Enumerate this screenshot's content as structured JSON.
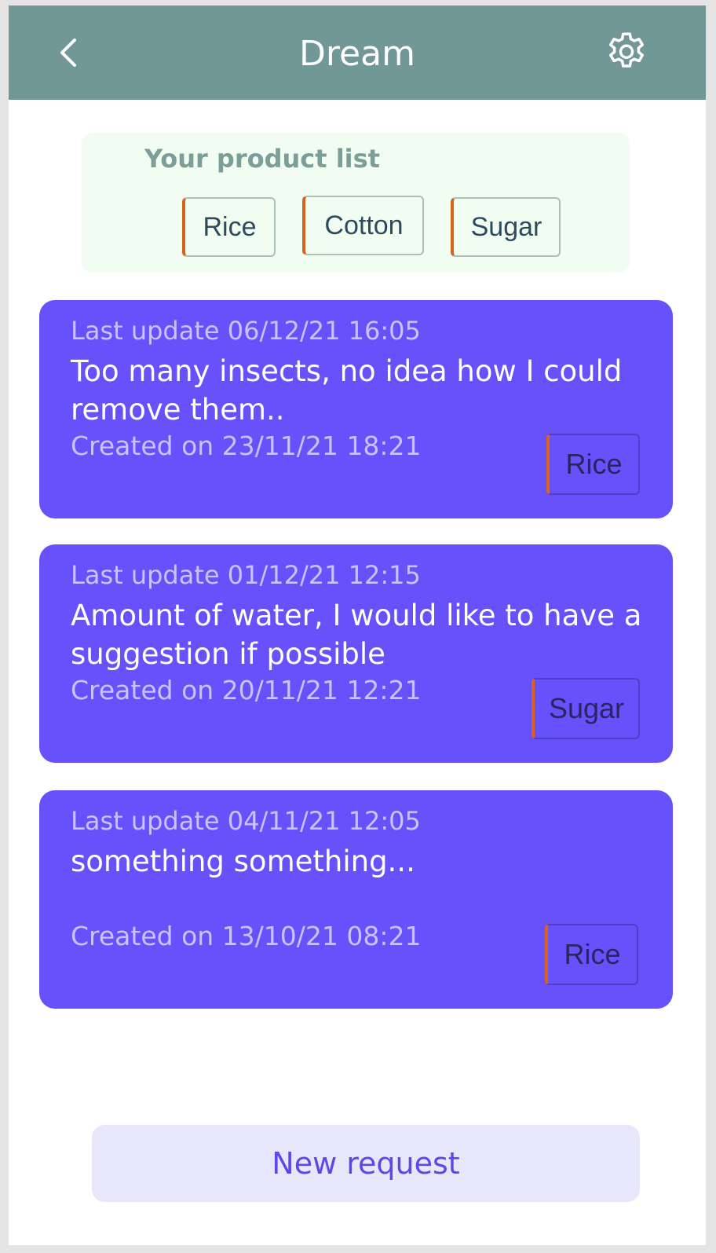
{
  "header": {
    "title": "Dream",
    "back_icon": "chevron-left-icon",
    "settings_icon": "gear-icon"
  },
  "product_list": {
    "title": "Your product list",
    "products": [
      "Rice",
      "Cotton",
      "Sugar"
    ]
  },
  "requests": [
    {
      "last_update": "Last update 06/12/21 16:05",
      "message": "Too many insects, no idea how I could remove them..",
      "created": "Created on 23/11/21 18:21",
      "tag": "Rice"
    },
    {
      "last_update": "Last update 01/12/21 12:15",
      "message": "Amount of water, I would like to have a suggestion if possible",
      "created": "Created on 20/11/21 12:21",
      "tag": "Sugar"
    },
    {
      "last_update": "Last update 04/11/21 12:05",
      "message": "something something...",
      "created": "Created on 13/10/21 08:21",
      "tag": "Rice"
    }
  ],
  "footer": {
    "new_request_label": "New request"
  },
  "colors": {
    "header": "#729797",
    "card": "#6651fb",
    "accent": "#d9631e",
    "product_box": "#f0fdf0",
    "button_bg": "#e7e6fb",
    "button_text": "#5a49e8"
  }
}
